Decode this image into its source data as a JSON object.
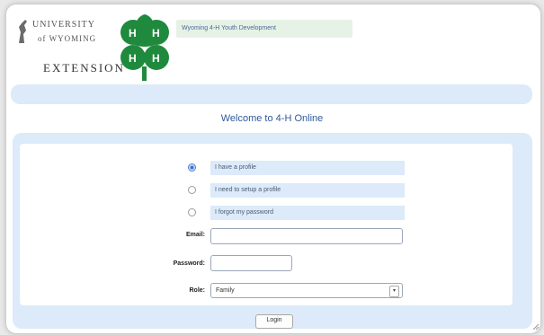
{
  "header": {
    "logo": {
      "line1": "UNIVERSITY",
      "line2": "of WYOMING",
      "extension": "EXTENSION"
    },
    "banner_text": "Wyoming 4-H Youth Development"
  },
  "main": {
    "welcome_title": "Welcome to 4-H Online"
  },
  "login_form": {
    "options": [
      {
        "label": "I have a profile",
        "checked": true
      },
      {
        "label": "I need to setup a profile",
        "checked": false
      },
      {
        "label": "I forgot my password",
        "checked": false
      }
    ],
    "email_label": "Email:",
    "email_value": "",
    "password_label": "Password:",
    "password_value": "",
    "role_label": "Role:",
    "role_value": "Family",
    "login_label": "Login"
  },
  "colors": {
    "nav_bg": "#dceafa",
    "banner_bg": "#e6f2e6",
    "clover_green": "#1f8a3d",
    "welcome_blue": "#2f5b9b"
  },
  "icons": [
    "clover-logo-icon",
    "uw-bucking-horse-icon",
    "radio-icon",
    "select-arrow-icon",
    "resize-grip-icon"
  ]
}
